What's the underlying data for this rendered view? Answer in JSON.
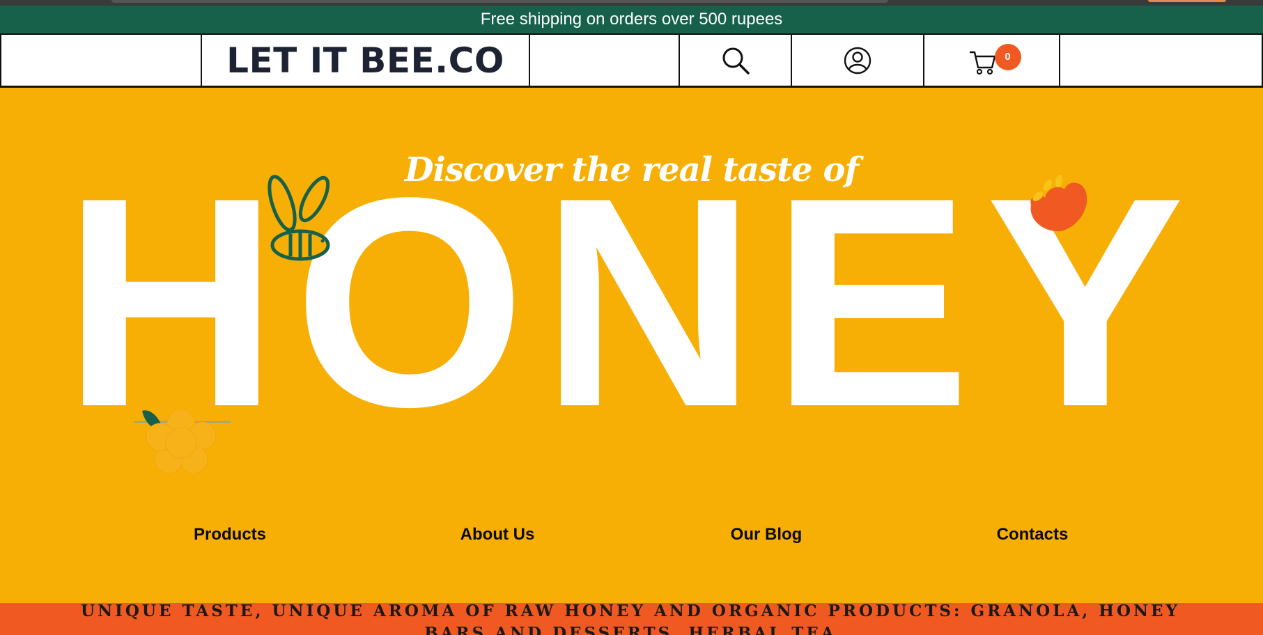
{
  "announcement": "Free shipping on orders over 500 rupees",
  "header": {
    "brand": "LET IT BEE.CO",
    "icons": [
      "search-icon",
      "user-icon",
      "cart-icon"
    ],
    "cart_count": "0"
  },
  "hero": {
    "tagline": "Discover the real taste of",
    "word": "HONEY"
  },
  "nav": {
    "items": [
      {
        "label": "Products"
      },
      {
        "label": "About Us"
      },
      {
        "label": "Our Blog"
      },
      {
        "label": "Contacts"
      }
    ]
  },
  "marquee": "UNIQUE TASTE, UNIQUE AROMA OF RAW HONEY AND ORGANIC PRODUCTS: GRANOLA, HONEY BARS AND DESSERTS, HERBAL TEA",
  "colors": {
    "hero_bg": "#f7af05",
    "announcement_bg": "#17604a",
    "accent": "#f05a22",
    "brand_text": "#1d2333"
  }
}
